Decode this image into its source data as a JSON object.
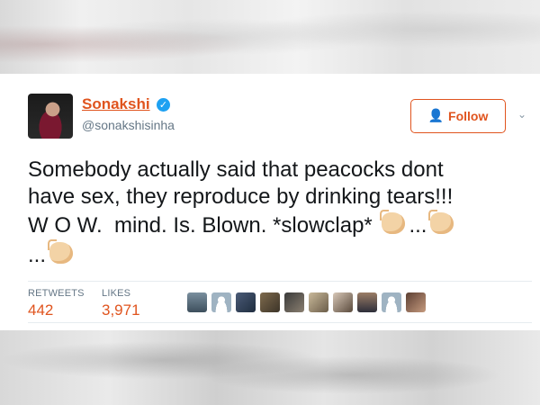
{
  "tweet": {
    "display_name": "Sonakshi",
    "handle": "@sonakshisinha",
    "follow_label": "Follow",
    "text_lines": [
      "Somebody actually said that peacocks dont",
      "have sex, they reproduce by drinking tears!!!",
      "W O W.  mind. Is. Blown. *slowclap* ",
      "..."
    ],
    "text_after_clap": "...",
    "stats": {
      "retweets_label": "RETWEETS",
      "retweets_value": "442",
      "likes_label": "LIKES",
      "likes_value": "3,971"
    },
    "liker_avatar_count": 10
  },
  "colors": {
    "accent": "#e0541e",
    "verified": "#1da1f2",
    "text": "#14171a",
    "muted": "#657786"
  },
  "icons": {
    "verified": "verified-badge-icon",
    "follow": "add-user-icon",
    "menu": "chevron-down-icon",
    "clap": "clapping-hands-icon"
  }
}
